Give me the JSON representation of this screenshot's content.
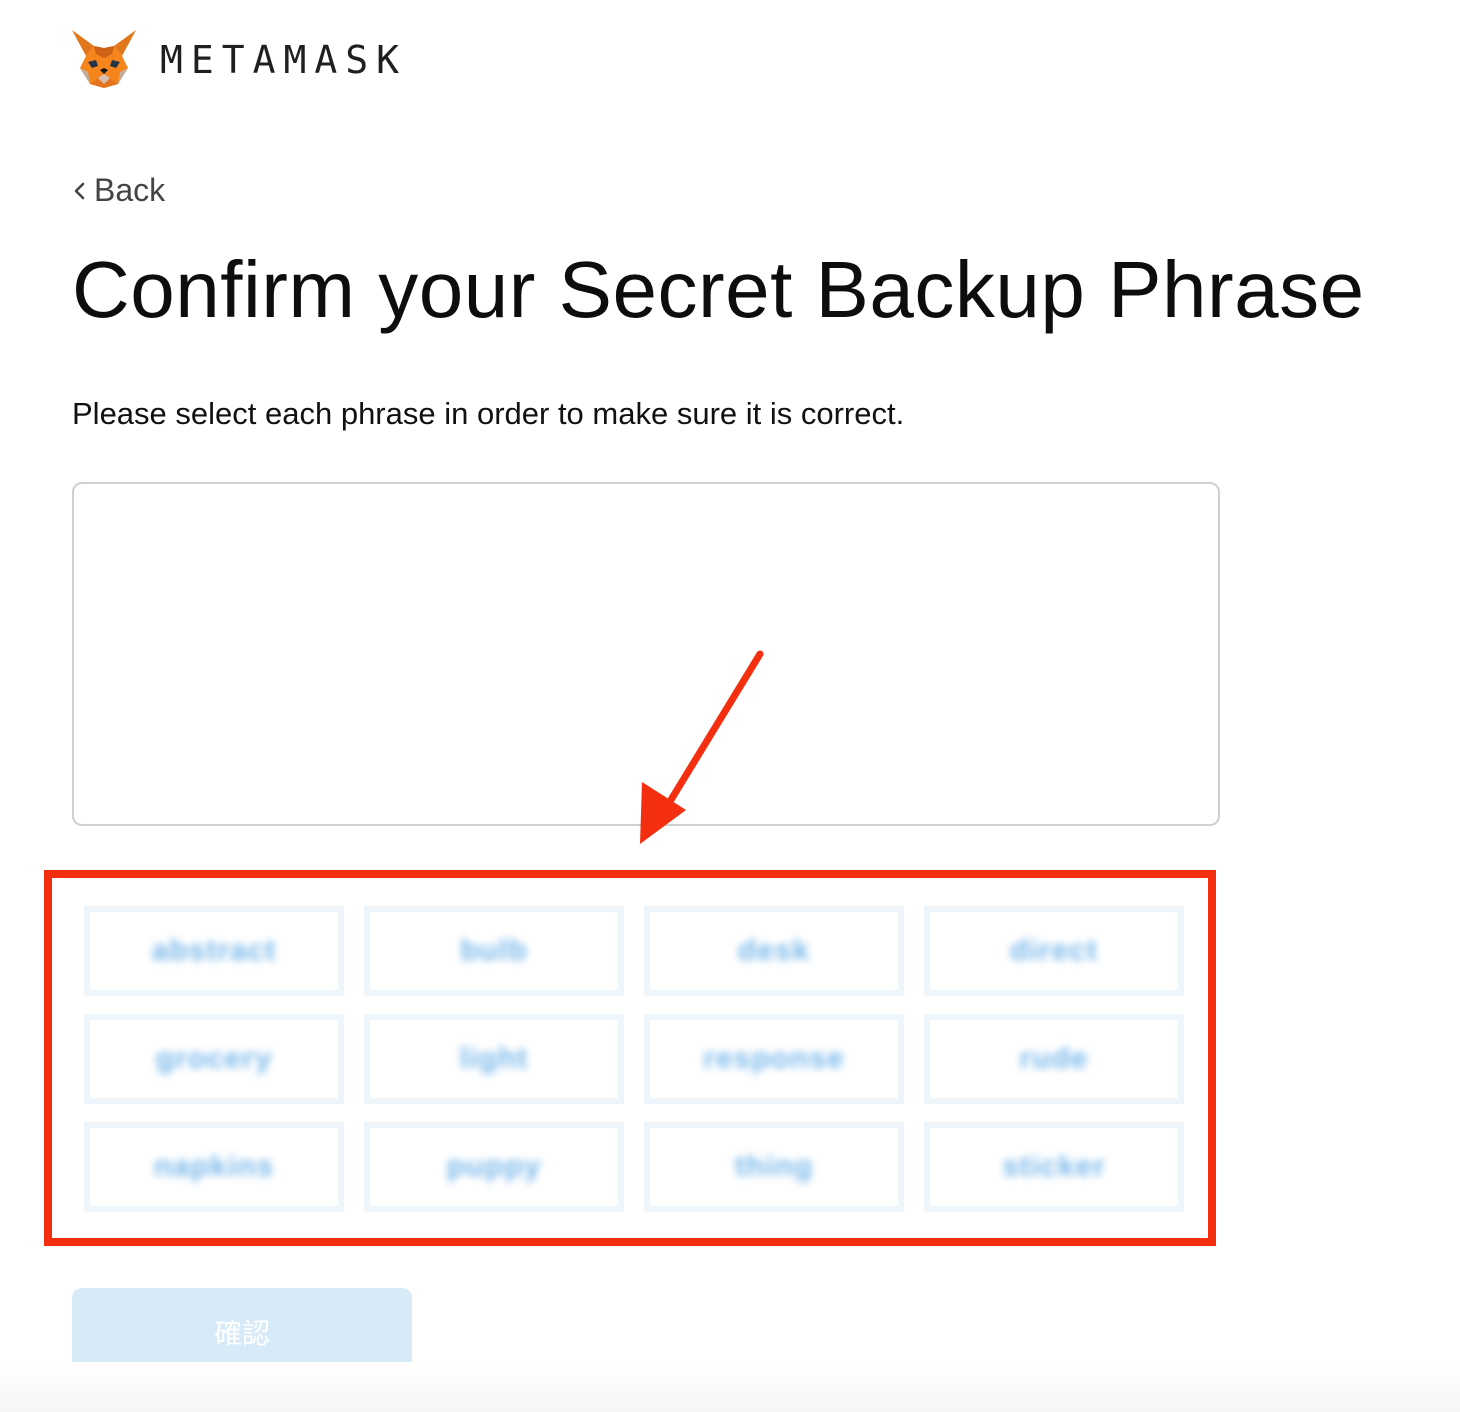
{
  "header": {
    "logo_icon": "metamask-fox-icon",
    "wordmark": "METAMASK"
  },
  "nav": {
    "back_label": "Back",
    "back_icon": "chevron-left-icon"
  },
  "main": {
    "title": "Confirm your Secret Backup Phrase",
    "instruction": "Please select each phrase in order to make sure it is correct.",
    "words": [
      "abstract",
      "bulb",
      "desk",
      "direct",
      "grocery",
      "light",
      "response",
      "rude",
      "napkins",
      "puppy",
      "thing",
      "sticker"
    ],
    "confirm_label": "確認"
  },
  "annotation": {
    "arrow_icon": "red-arrow-icon",
    "color": "#f42f10"
  },
  "colors": {
    "word_text": "#4a9fe3",
    "chip_border": "#eef5fb",
    "confirm_bg": "#d7eaf8"
  }
}
